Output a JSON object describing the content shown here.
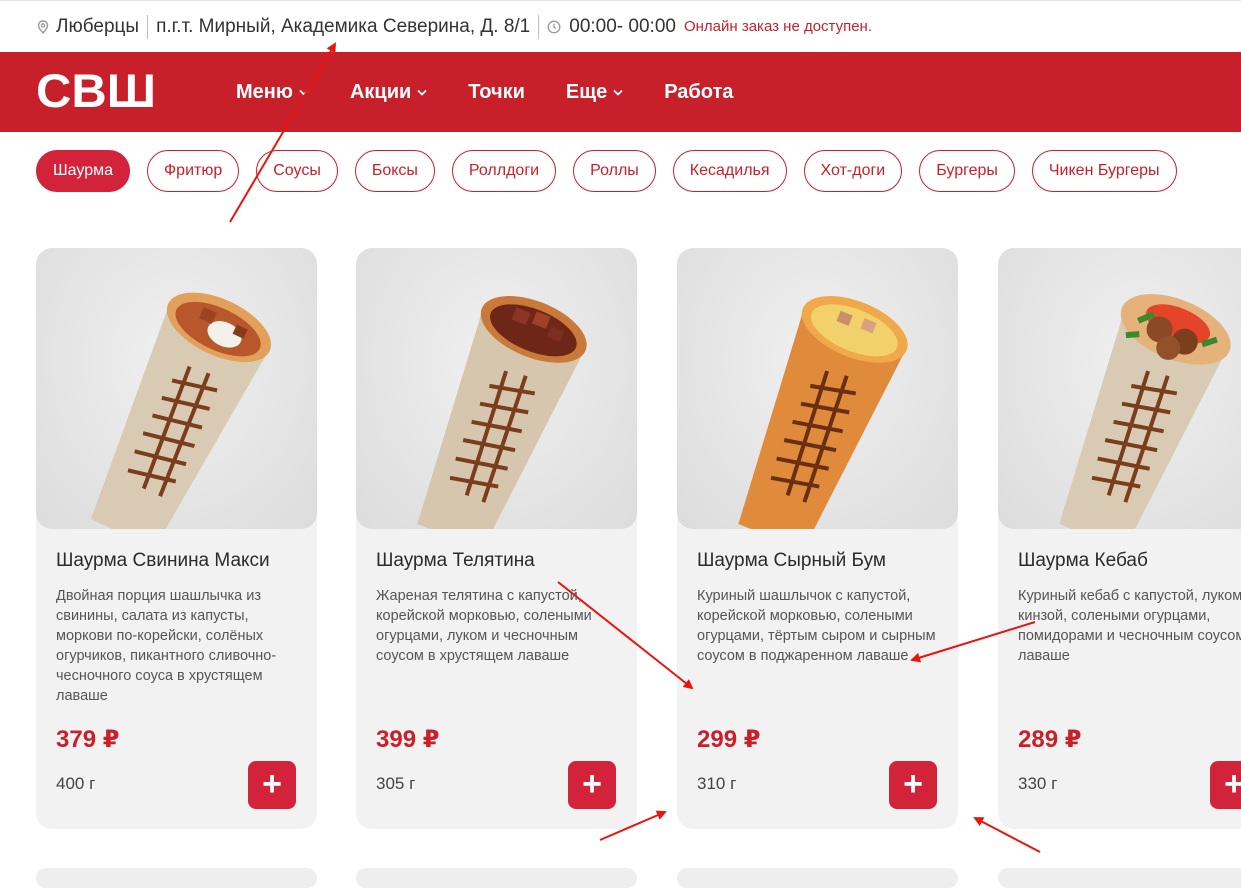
{
  "topbar": {
    "city": "Люберцы",
    "address": "п.г.т. Мирный, Академика Северина, Д. 8/1",
    "hours": "00:00- 00:00",
    "warning": "Онлайн заказ не доступен."
  },
  "header": {
    "logo": "СВШ",
    "nav": [
      {
        "label": "Меню"
      },
      {
        "label": "Акции"
      },
      {
        "label": "Точки"
      },
      {
        "label": "Еще"
      },
      {
        "label": "Работа"
      }
    ]
  },
  "categories": [
    "Шаурма",
    "Фритюр",
    "Соусы",
    "Боксы",
    "Роллдоги",
    "Роллы",
    "Кесадилья",
    "Хот-доги",
    "Бургеры",
    "Чикен Бургеры"
  ],
  "products": [
    {
      "title": "Шаурма Свинина Макси",
      "desc": "Двойная порция шашлычка из свинины, салата из капусты, моркови по-корейски, солёных огурчиков, пикантного сливочно-чесночного соуса в хрустящем лаваше",
      "price": "379 ₽",
      "weight": "400 г",
      "add": "+"
    },
    {
      "title": "Шаурма Телятина",
      "desc": "Жареная телятина с капустой, корейской морковью, солеными огурцами, луком и чесночным соусом в хрустящем лаваше",
      "price": "399 ₽",
      "weight": "305 г",
      "add": "+"
    },
    {
      "title": "Шаурма Сырный Бум",
      "desc": "Куриный шашлычок с капустой, корейской морковью, солеными огурцами, тёртым сыром и сырным соусом в поджаренном лаваше",
      "price": "299 ₽",
      "weight": "310 г",
      "add": "+"
    },
    {
      "title": "Шаурма Кебаб",
      "desc": "Куриный кебаб с капустой, луком, кинзой, солеными огурцами, помидорами и чесночным соусом в лаваше",
      "price": "289 ₽",
      "weight": "330 г",
      "add": "+"
    }
  ],
  "colors": {
    "brand_red": "#c8202a",
    "active_chip": "#d2233a",
    "annotation_arrow": "#e8140e"
  }
}
